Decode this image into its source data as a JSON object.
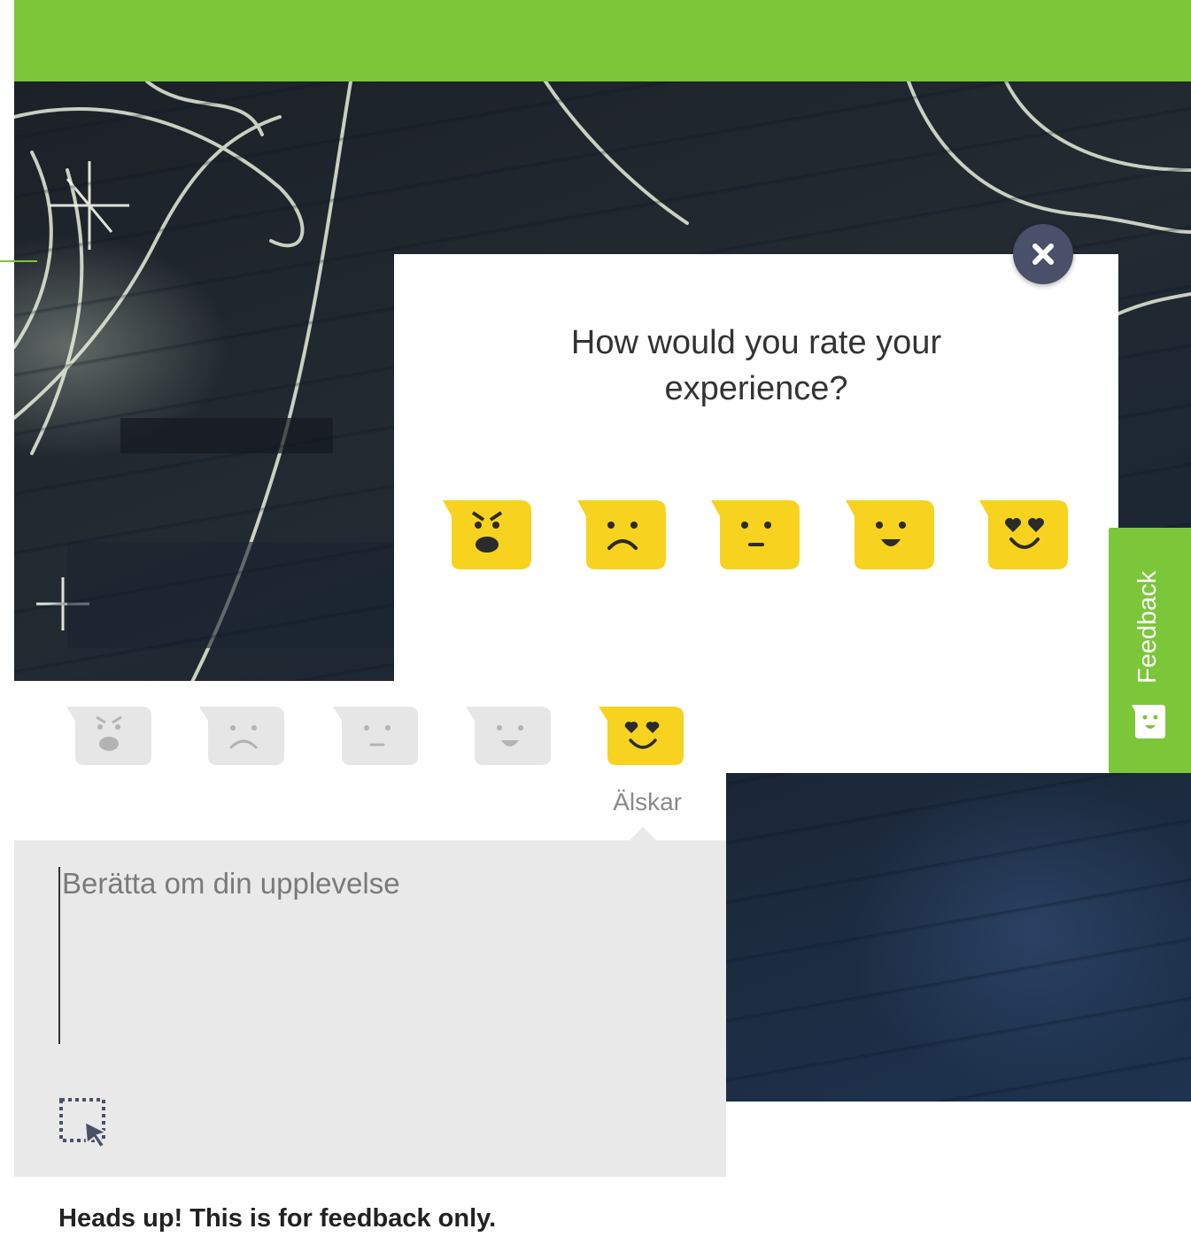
{
  "header": {
    "color": "#7cc63a"
  },
  "modal": {
    "question": "How would you rate your experience?",
    "close_icon": "close-icon",
    "faces": [
      {
        "name": "angry-face-icon",
        "mood": "angry"
      },
      {
        "name": "sad-face-icon",
        "mood": "sad"
      },
      {
        "name": "neutral-face-icon",
        "mood": "neutral"
      },
      {
        "name": "happy-face-icon",
        "mood": "happy"
      },
      {
        "name": "love-face-icon",
        "mood": "love"
      }
    ]
  },
  "feedback_tab": {
    "label": "Feedback",
    "icon": "smiley-icon"
  },
  "panel": {
    "faces": [
      {
        "name": "angry-face-icon",
        "selected": false
      },
      {
        "name": "sad-face-icon",
        "selected": false
      },
      {
        "name": "neutral-face-icon",
        "selected": false
      },
      {
        "name": "happy-face-icon",
        "selected": false
      },
      {
        "name": "love-face-icon",
        "selected": true
      }
    ],
    "selected_label": "Älskar",
    "comment_placeholder": "Berätta om din upplevelse",
    "screenshot_icon": "screenshot-select-icon",
    "notice": "Heads up! This is for feedback only."
  },
  "colors": {
    "accent": "#7cc63a",
    "face_yellow": "#f7d21f",
    "face_grey": "#e6e6e6",
    "close_bg": "#4a4f6a"
  }
}
